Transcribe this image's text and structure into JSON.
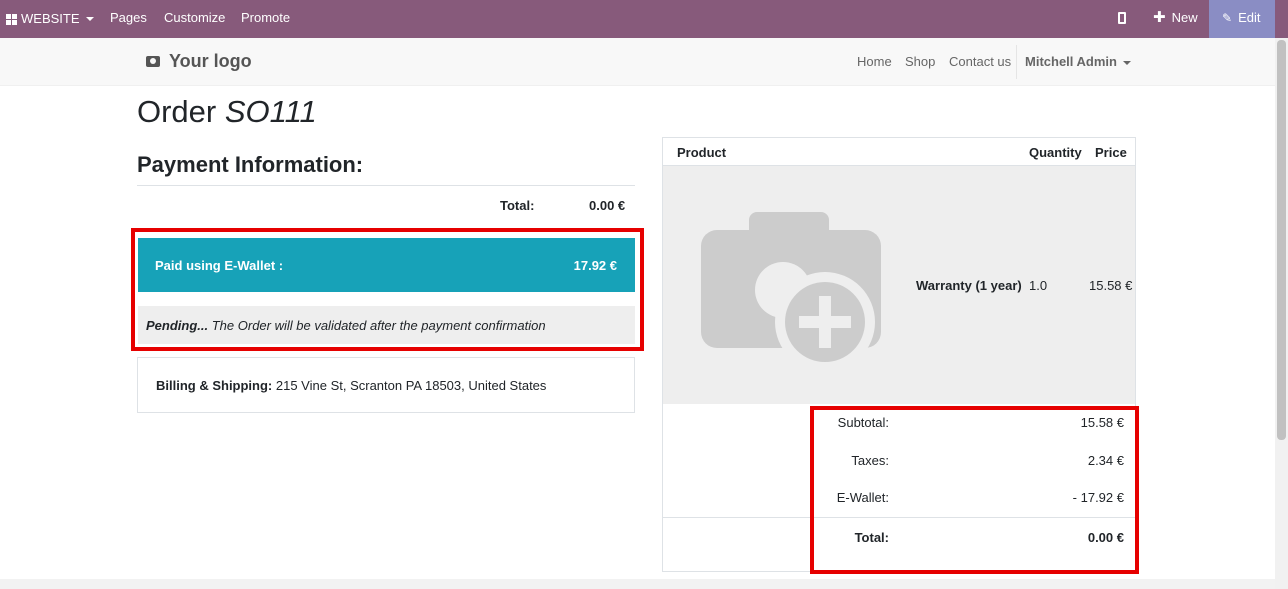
{
  "topbar": {
    "website": "WEBSITE",
    "pages": "Pages",
    "customize": "Customize",
    "promote": "Promote",
    "new": "New",
    "edit": "Edit",
    "color": "#875a7b",
    "edit_color": "#8a8dc4"
  },
  "header": {
    "logo": "Your logo",
    "nav": {
      "home": "Home",
      "shop": "Shop",
      "contact": "Contact us",
      "user": "Mitchell Admin"
    }
  },
  "order": {
    "title_prefix": "Order",
    "number": "SO111"
  },
  "payment": {
    "heading": "Payment Information:",
    "total_label": "Total:",
    "total_value": "0.00 €",
    "wallet_label": "Paid using E-Wallet :",
    "wallet_value": "17.92 €",
    "wallet_color": "#17a2b8",
    "pending_strong": "Pending...",
    "pending_text": " The Order will be validated after the payment confirmation",
    "billing_label": "Billing & Shipping:",
    "billing_address": " 215 Vine St, Scranton PA 18503, United States"
  },
  "cart": {
    "columns": {
      "product": "Product",
      "quantity": "Quantity",
      "price": "Price"
    },
    "items": [
      {
        "name": "Warranty (1 year)",
        "quantity": "1.0",
        "price": "15.58 €",
        "image": "camera-placeholder-icon"
      }
    ],
    "summary": {
      "subtotal_label": "Subtotal:",
      "subtotal_value": "15.58 €",
      "taxes_label": "Taxes:",
      "taxes_value": "2.34 €",
      "wallet_label": "E-Wallet:",
      "wallet_value": "- 17.92 €",
      "total_label": "Total:",
      "total_value": "0.00 €"
    }
  },
  "highlight_color": "#e60000"
}
